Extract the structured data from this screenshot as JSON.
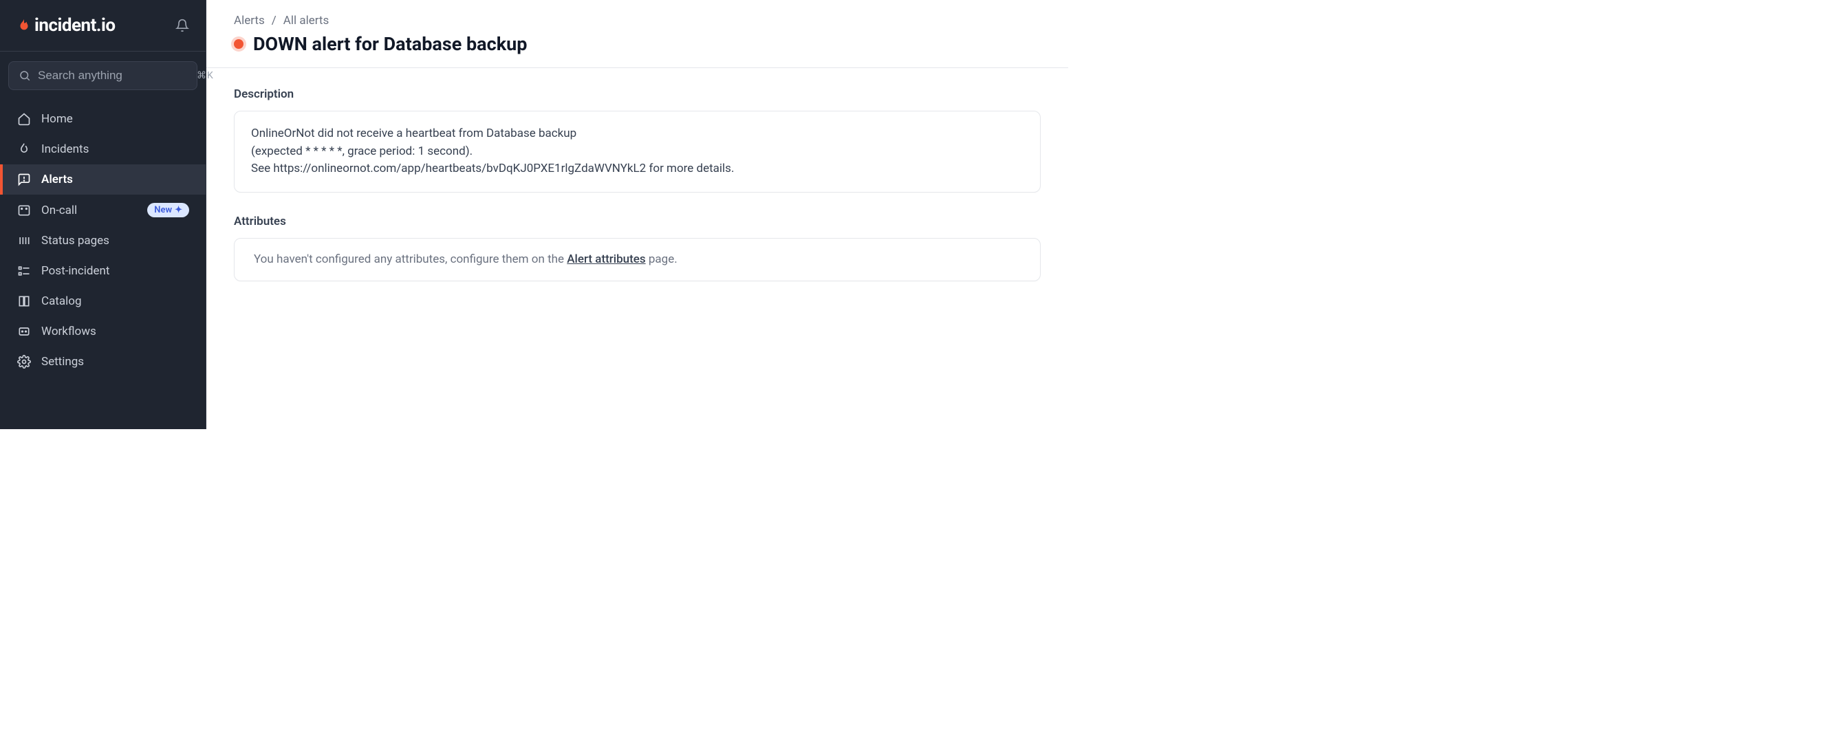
{
  "brand": "incident.io",
  "search": {
    "placeholder": "Search anything",
    "kbd": "⌘K"
  },
  "nav": {
    "home": "Home",
    "incidents": "Incidents",
    "alerts": "Alerts",
    "oncall": "On-call",
    "oncall_badge": "New",
    "status_pages": "Status pages",
    "post_incident": "Post-incident",
    "catalog": "Catalog",
    "workflows": "Workflows",
    "settings": "Settings"
  },
  "breadcrumb": {
    "root": "Alerts",
    "sep": "/",
    "current": "All alerts"
  },
  "title": "DOWN alert for Database backup",
  "description": {
    "label": "Description",
    "line1": "OnlineOrNot did not receive a heartbeat from Database backup",
    "line2": "(expected * * * * *, grace period: 1 second).",
    "line3_pre": "See ",
    "line3_url": "https://onlineornot.com/app/heartbeats/bvDqKJ0PXE1rlgZdaWVNYkL2",
    "line3_post": " for more details."
  },
  "attributes": {
    "label": "Attributes",
    "empty_pre": "You haven't configured any attributes, configure them on the ",
    "empty_link": "Alert attributes",
    "empty_post": " page."
  }
}
